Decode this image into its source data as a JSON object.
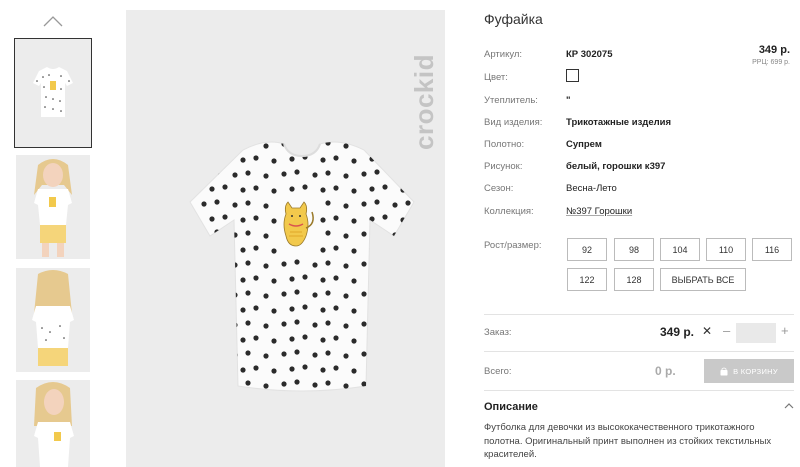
{
  "product": {
    "title": "Фуфайка",
    "brand": "crockid"
  },
  "gallery": {
    "thumbnails": [
      {
        "alt": "front view",
        "selected": true
      },
      {
        "alt": "girl front",
        "selected": false
      },
      {
        "alt": "girl back",
        "selected": false
      },
      {
        "alt": "girl side",
        "selected": false
      }
    ]
  },
  "details": {
    "article_label": "Артикул:",
    "article_value": "КР 302075",
    "color_label": "Цвет:",
    "insulation_label": "Утеплитель:",
    "insulation_value": "\"",
    "type_label": "Вид изделия:",
    "type_value": "Трикотажные изделия",
    "fabric_label": "Полотно:",
    "fabric_value": "Супрем",
    "pattern_label": "Рисунок:",
    "pattern_value": "белый, горошки к397",
    "season_label": "Сезон:",
    "season_value": "Весна-Лето",
    "collection_label": "Коллекция:",
    "collection_value": "№397 Горошки"
  },
  "price": {
    "main": "349 р.",
    "rrp": "РРЦ: 699 р."
  },
  "sizes": {
    "label": "Рост/размер:",
    "options": [
      "92",
      "98",
      "104",
      "110",
      "116",
      "122",
      "128"
    ],
    "select_all": "ВЫБРАТЬ ВСЕ"
  },
  "order": {
    "label": "Заказ:",
    "price": "349 р.",
    "times": "✕",
    "minus": "–",
    "plus": "+",
    "qty": ""
  },
  "total": {
    "label": "Всего:",
    "value": "0 р.",
    "cart_button": "В КОРЗИНУ"
  },
  "description": {
    "title": "Описание",
    "text": "Футболка для девочки из высококачественного трикотажного полотна. Оригинальный принт выполнен из стойких текстильных красителей."
  },
  "colors": {
    "image_bg": "#ececec",
    "dot": "#2b2b2b",
    "cat": "#f2c94c",
    "button_disabled": "#c9c9c9"
  }
}
